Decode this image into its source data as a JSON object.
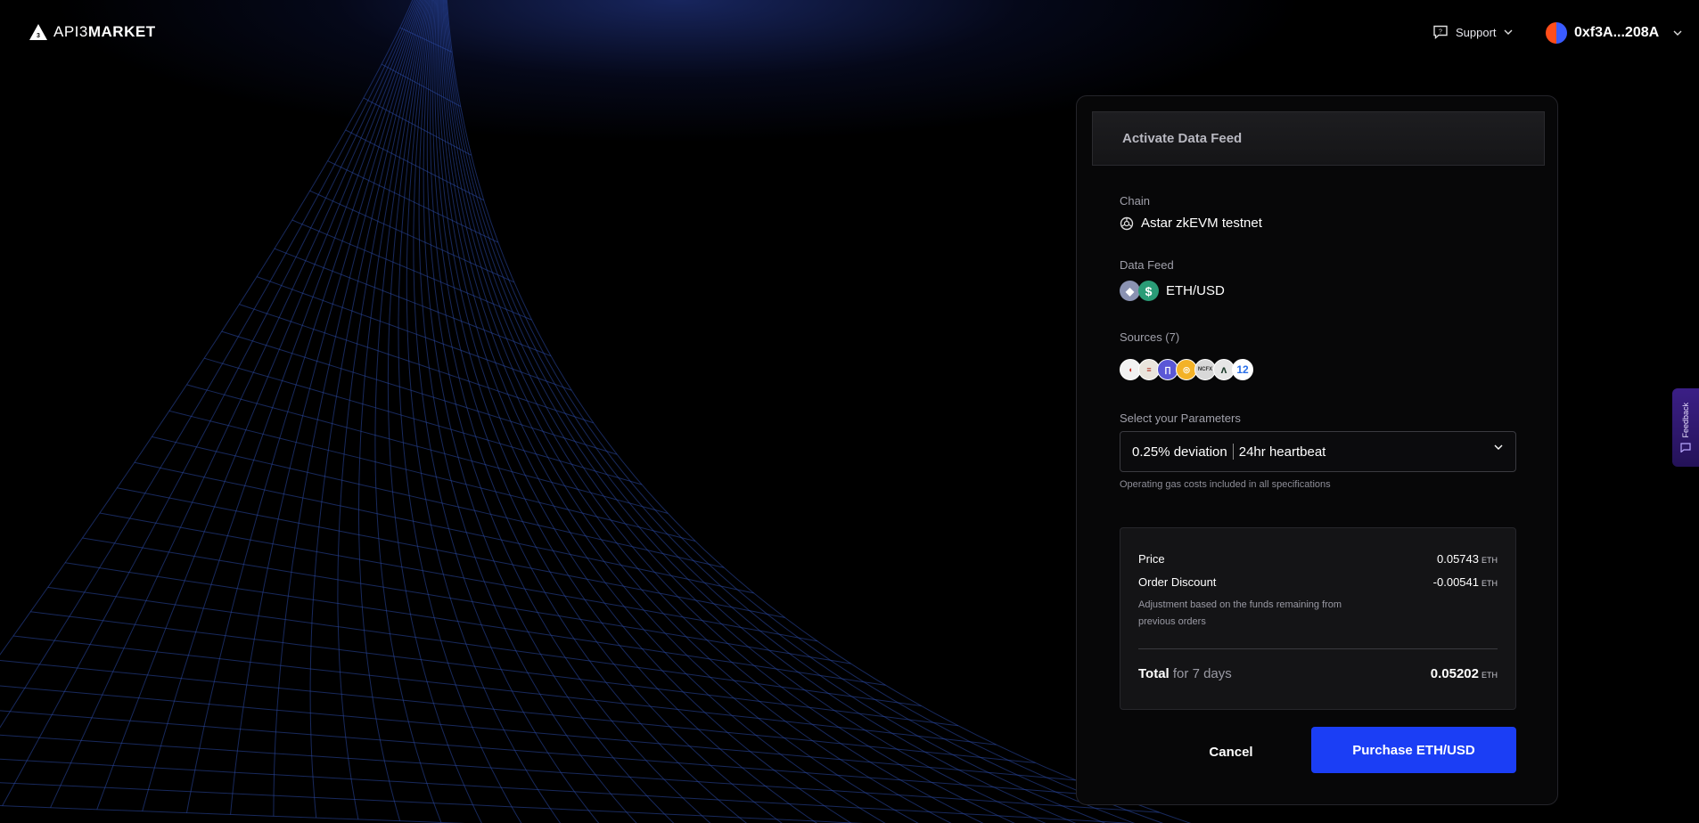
{
  "header": {
    "logo": {
      "brand": "API3",
      "product": "MARKET"
    },
    "support_label": "Support",
    "wallet_address": "0xf3A...208A"
  },
  "card": {
    "title": "Activate Data Feed",
    "chain": {
      "label": "Chain",
      "value": "Astar zkEVM testnet"
    },
    "data_feed": {
      "label": "Data Feed",
      "value": "ETH/USD",
      "icons": [
        "eth-icon",
        "usd-icon"
      ]
    },
    "sources": {
      "label": "Sources (7)",
      "icons": [
        "source-1-icon",
        "source-2-icon",
        "source-3-icon",
        "source-4-icon",
        "source-5-icon",
        "source-6-icon",
        "source-7-icon"
      ]
    },
    "parameters": {
      "label": "Select your Parameters",
      "deviation": "0.25% deviation",
      "heartbeat": "24hr heartbeat",
      "hint": "Operating gas costs included in all specifications"
    },
    "pricing": {
      "price_label": "Price",
      "price_value": "0.05743",
      "discount_label": "Order Discount",
      "discount_value": "-0.00541",
      "discount_note": "Adjustment based on the funds remaining from previous orders",
      "total_label": "Total",
      "total_period": "for 7 days",
      "total_value": "0.05202",
      "unit": "ETH"
    },
    "cancel_label": "Cancel",
    "purchase_label": "Purchase ETH/USD"
  },
  "feedback_label": "Feedback",
  "colors": {
    "accent": "#1b3ef5",
    "background": "#000000",
    "grid": "#2b4aa8"
  }
}
